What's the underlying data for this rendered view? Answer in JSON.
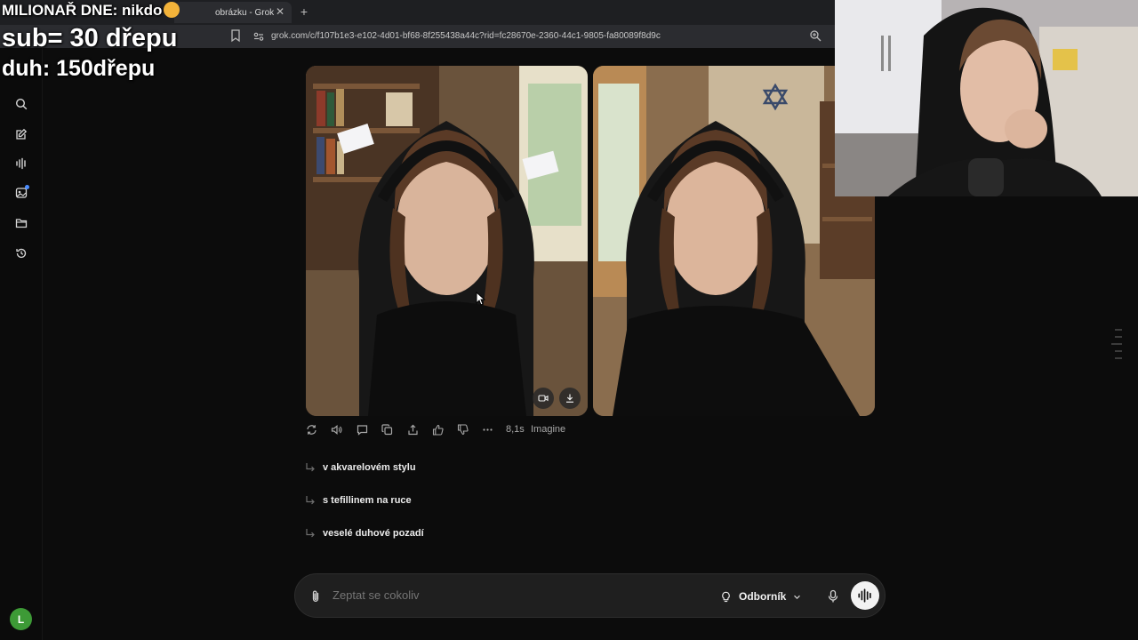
{
  "browser": {
    "tab_title": "obrázku - Grok",
    "url": "grok.com/c/f107b1e3-e102-4d01-bf68-8f255438a44c?rid=fc28670e-2360-44c1-9805-fa80089f8d9c"
  },
  "overlay": {
    "line1": "MILIONAŘ DNE: nikdo",
    "line2": "sub= 30 dřepu",
    "line3": "duh: 150dřepu"
  },
  "sidebar": {
    "items": [
      {
        "icon": "search-icon"
      },
      {
        "icon": "edit-icon"
      },
      {
        "icon": "voice-icon"
      },
      {
        "icon": "imagine-icon"
      },
      {
        "icon": "folder-icon"
      },
      {
        "icon": "history-icon"
      }
    ],
    "avatar_letter": "L"
  },
  "response": {
    "time": "8,1s",
    "model": "Imagine"
  },
  "suggestions": [
    "v akvarelovém stylu",
    "s tefillinem na ruce",
    "veselé duhové pozadí"
  ],
  "chat": {
    "placeholder": "Zeptat se cokoliv",
    "mode": "Odborník"
  },
  "colors": {
    "background": "#0c0c0c",
    "input_bg": "#1f1f1f",
    "avatar": "#3d9a36",
    "notification": "#4a8cff"
  }
}
